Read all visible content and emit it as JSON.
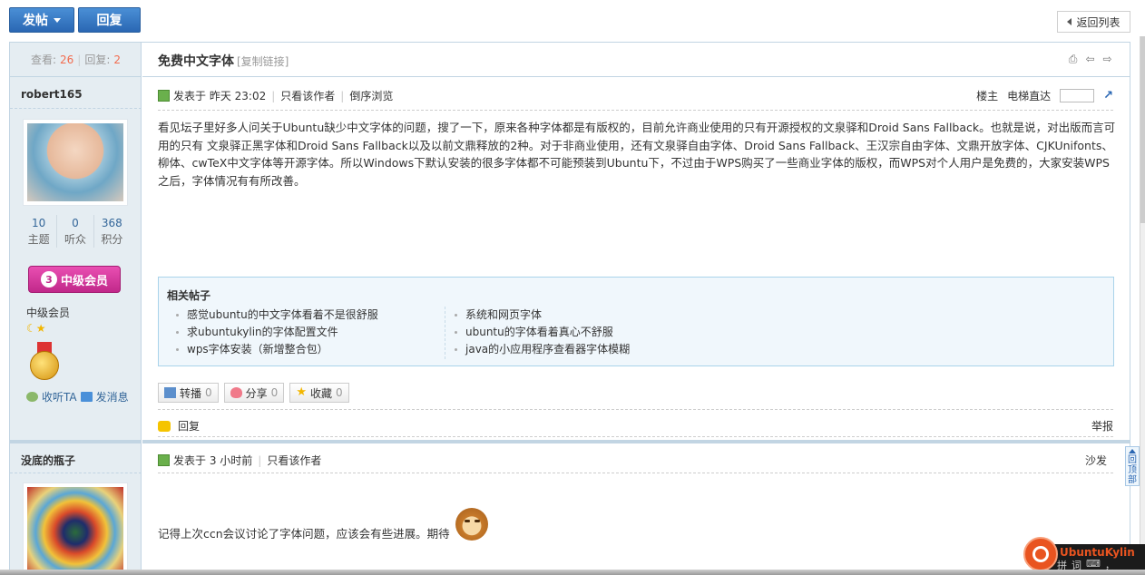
{
  "toolbar": {
    "post_label": "发帖",
    "reply_label": "回复",
    "back_label": "返回列表"
  },
  "thread": {
    "views_label": "查看:",
    "views": "26",
    "replies_label": "回复:",
    "replies": "2",
    "title": "免费中文字体",
    "copy_link": "[复制链接]"
  },
  "post1": {
    "author": "robert165",
    "user_stats": [
      {
        "value": "10",
        "label": "主题"
      },
      {
        "value": "0",
        "label": "听众"
      },
      {
        "value": "368",
        "label": "积分"
      }
    ],
    "rank_badge": "中级会员",
    "rank_badge_num": "3",
    "rank_text": "中级会员",
    "follow_label": "收听TA",
    "message_label": "发消息",
    "posted_at": "发表于 昨天 23:02",
    "only_author": "只看该作者",
    "reverse": "倒序浏览",
    "floor": "楼主",
    "elevator": "电梯直达",
    "body": "看见坛子里好多人问关于Ubuntu缺少中文字体的问题，搜了一下，原来各种字体都是有版权的，目前允许商业使用的只有开源授权的文泉驿和Droid Sans Fallback。也就是说，对出版而言可用的只有 文泉驿正黑字体和Droid Sans Fallback以及以前文鼎释放的2种。对于非商业使用，还有文泉驿自由字体、Droid Sans Fallback、王汉宗自由字体、文鼎开放字体、CJKUnifonts、 柳体、cwTeX中文字体等开源字体。所以Windows下默认安装的很多字体都不可能预装到Ubuntu下，不过由于WPS购买了一些商业字体的版权，而WPS对个人用户是免费的，大家安装WPS之后，字体情况有有所改善。",
    "related_title": "相关帖子",
    "related_left": [
      "感觉ubuntu的中文字体看着不是很舒服",
      "求ubuntukylin的字体配置文件",
      "wps字体安装（新增整合包）"
    ],
    "related_right": [
      "系统和网页字体",
      "ubuntu的字体看着真心不舒服",
      "java的小应用程序查看器字体模糊"
    ],
    "forward_label": "转播",
    "forward_count": "0",
    "share_label": "分享",
    "share_count": "0",
    "fav_label": "收藏",
    "fav_count": "0",
    "reply_label": "回复",
    "report_label": "举报"
  },
  "post2": {
    "author": "没底的瓶子",
    "posted_at": "发表于 3 小时前",
    "only_author": "只看该作者",
    "floor": "沙发",
    "body": "记得上次ccn会议讨论了字体问题，应该会有些进展。期待"
  },
  "widgets": {
    "back_top": "回顶部",
    "ime_brand": "UbuntuKylin",
    "ime_items": [
      "拼",
      "词",
      "⌨",
      "，"
    ]
  },
  "colors": {
    "primary_button": "#2a67b3",
    "accent_count": "#f26c4f",
    "sidebar_bg": "#e5edf2",
    "border": "#c2d5e3",
    "related_bg": "#f0f7fc",
    "badge_pink": "#c1288a",
    "ubuntu_orange": "#e95420"
  }
}
